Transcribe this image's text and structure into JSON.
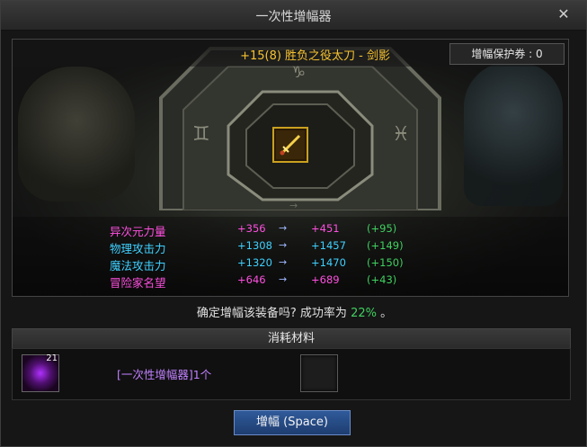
{
  "window": {
    "title": "一次性增幅器",
    "close_glyph": "✕"
  },
  "item": {
    "name": "+15(8) 胜负之役太刀 - 剑影",
    "icon": "sword-icon"
  },
  "protection": {
    "label": "增幅保护券 : 0"
  },
  "stats": [
    {
      "name": "异次元力量",
      "old": "+356",
      "new": "+451",
      "diff": "(+95)",
      "color": "#ff4fe0"
    },
    {
      "name": "物理攻击力",
      "old": "+1308",
      "new": "+1457",
      "diff": "(+149)",
      "color": "#3fd0ff"
    },
    {
      "name": "魔法攻击力",
      "old": "+1320",
      "new": "+1470",
      "diff": "(+150)",
      "color": "#3fd0ff"
    },
    {
      "name": "冒险家名望",
      "old": "+646",
      "new": "+689",
      "diff": "(+43)",
      "color": "#ff4fe0"
    }
  ],
  "stat_arrow": "→",
  "confirm": {
    "prefix": "确定增幅该装备吗? 成功率为 ",
    "rate": "22%",
    "suffix": " 。"
  },
  "materials": {
    "header": "消耗材料",
    "count": "21",
    "name": "[一次性增幅器]1个",
    "icon": "amplifier-orb-icon"
  },
  "action": {
    "button_label": "增幅 (Space)"
  },
  "colors": {
    "item_name": "#f7c230",
    "diff_green": "#40d060",
    "material_purple": "#c080ff",
    "button_blue": "#2f5a9a"
  }
}
